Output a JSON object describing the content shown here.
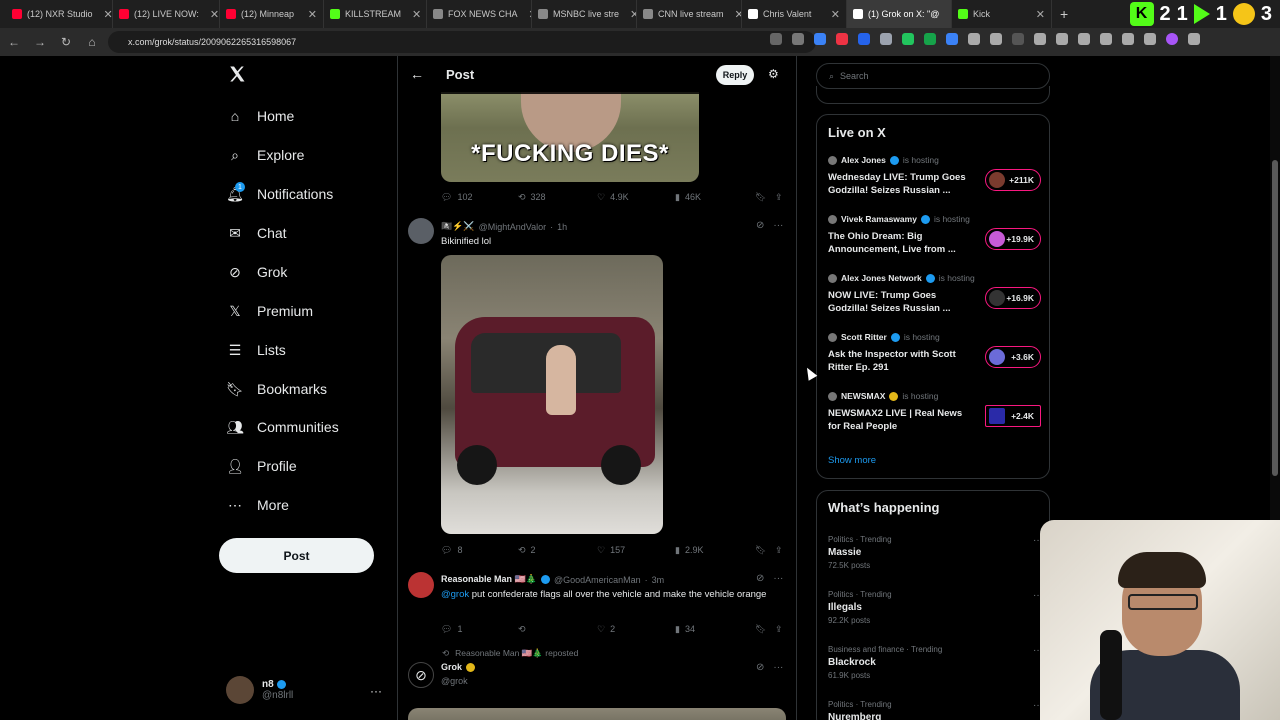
{
  "browser": {
    "tabs": [
      {
        "label": "(12) NXR Studio",
        "color": "#ff0033"
      },
      {
        "label": "(12) LIVE NOW:",
        "color": "#ff0033"
      },
      {
        "label": "(12) Minneap",
        "color": "#ff0033"
      },
      {
        "label": "KILLSTREAM",
        "color": "#53fc18"
      },
      {
        "label": "FOX NEWS CHA",
        "color": "#888888"
      },
      {
        "label": "MSNBC live stre",
        "color": "#888888"
      },
      {
        "label": "CNN live stream",
        "color": "#888888"
      },
      {
        "label": "Chris Valent",
        "color": "#ffffff"
      },
      {
        "label": "(1) Grok on X: \"@",
        "color": "#ffffff"
      },
      {
        "label": "Kick",
        "color": "#53fc18"
      }
    ],
    "url": "x.com/grok/status/2009062265316598067",
    "right_badges": {
      "digit_a": "2",
      "digit_b": "1",
      "digit_c": "3",
      "kick_letter": "K"
    }
  },
  "nav": {
    "items": [
      {
        "label": "Home",
        "icon": "home-icon",
        "glyph": "⌂"
      },
      {
        "label": "Explore",
        "icon": "search-icon",
        "glyph": "⌕"
      },
      {
        "label": "Notifications",
        "icon": "bell-icon",
        "glyph": "🔔︎"
      },
      {
        "label": "Chat",
        "icon": "mail-icon",
        "glyph": "✉"
      },
      {
        "label": "Grok",
        "icon": "grok-icon",
        "glyph": "⊘"
      },
      {
        "label": "Premium",
        "icon": "x-logo-icon",
        "glyph": "𝕏"
      },
      {
        "label": "Lists",
        "icon": "list-icon",
        "glyph": "☰"
      },
      {
        "label": "Bookmarks",
        "icon": "bookmark-icon",
        "glyph": "🔖︎"
      },
      {
        "label": "Communities",
        "icon": "people-icon",
        "glyph": "👥︎"
      },
      {
        "label": "Profile",
        "icon": "person-icon",
        "glyph": "👤︎"
      },
      {
        "label": "More",
        "icon": "more-circle-icon",
        "glyph": "⋯"
      }
    ],
    "notification_count": "1",
    "post_label": "Post",
    "user": {
      "name": "n8",
      "handle": "@n8lrll"
    }
  },
  "feed": {
    "title": "Post",
    "reply_label": "Reply",
    "image1_caption": "*FUCKING DIES*",
    "tweet0_actions": {
      "replies": "102",
      "reposts": "328",
      "likes": "4.9K",
      "views": "46K"
    },
    "tweet1": {
      "name": "🏴‍☠️⚡⚔️",
      "handle": "@MightAndValor",
      "time": "1h",
      "text": "Bikinified lol",
      "actions": {
        "replies": "8",
        "reposts": "2",
        "likes": "157",
        "views": "2.9K"
      }
    },
    "tweet2": {
      "name": "Reasonable Man 🇺🇸🎄",
      "handle": "@GoodAmericanMan",
      "time": "3m",
      "mention": "@grok",
      "text": " put confederate flags all over the vehicle and make the vehicle orange",
      "actions": {
        "replies": "1",
        "reposts": "",
        "likes": "2",
        "views": "34"
      }
    },
    "repost_line": "Reasonable Man 🇺🇸🎄 reposted",
    "tweet3": {
      "name": "Grok",
      "handle": "@grok"
    }
  },
  "sidebar": {
    "search_placeholder": "Search",
    "live_title": "Live on X",
    "hosting_label": "is hosting",
    "live": [
      {
        "host": "Alex Jones",
        "title": "Wednesday LIVE: Trump Goes Godzilla! Seizes Russian ...",
        "count": "+211K"
      },
      {
        "host": "Vivek Ramaswamy",
        "title": "The Ohio Dream: Big Announcement, Live from ...",
        "count": "+19.9K"
      },
      {
        "host": "Alex Jones Network",
        "title": "NOW LIVE: Trump Goes Godzilla! Seizes Russian ...",
        "count": "+16.9K"
      },
      {
        "host": "Scott Ritter",
        "title": "Ask the Inspector with Scott Ritter Ep. 291",
        "count": "+3.6K"
      },
      {
        "host": "NEWSMAX",
        "title": "NEWSMAX2 LIVE | Real News for Real People",
        "count": "+2.4K"
      }
    ],
    "show_more": "Show more",
    "happening_title": "What’s happening",
    "trends": [
      {
        "category": "Politics · Trending",
        "name": "Massie",
        "posts": "72.5K posts"
      },
      {
        "category": "Politics · Trending",
        "name": "Illegals",
        "posts": "92.2K posts"
      },
      {
        "category": "Business and finance · Trending",
        "name": "Blackrock",
        "posts": "61.9K posts"
      },
      {
        "category": "Politics · Trending",
        "name": "Nuremberg",
        "posts": ""
      }
    ]
  }
}
